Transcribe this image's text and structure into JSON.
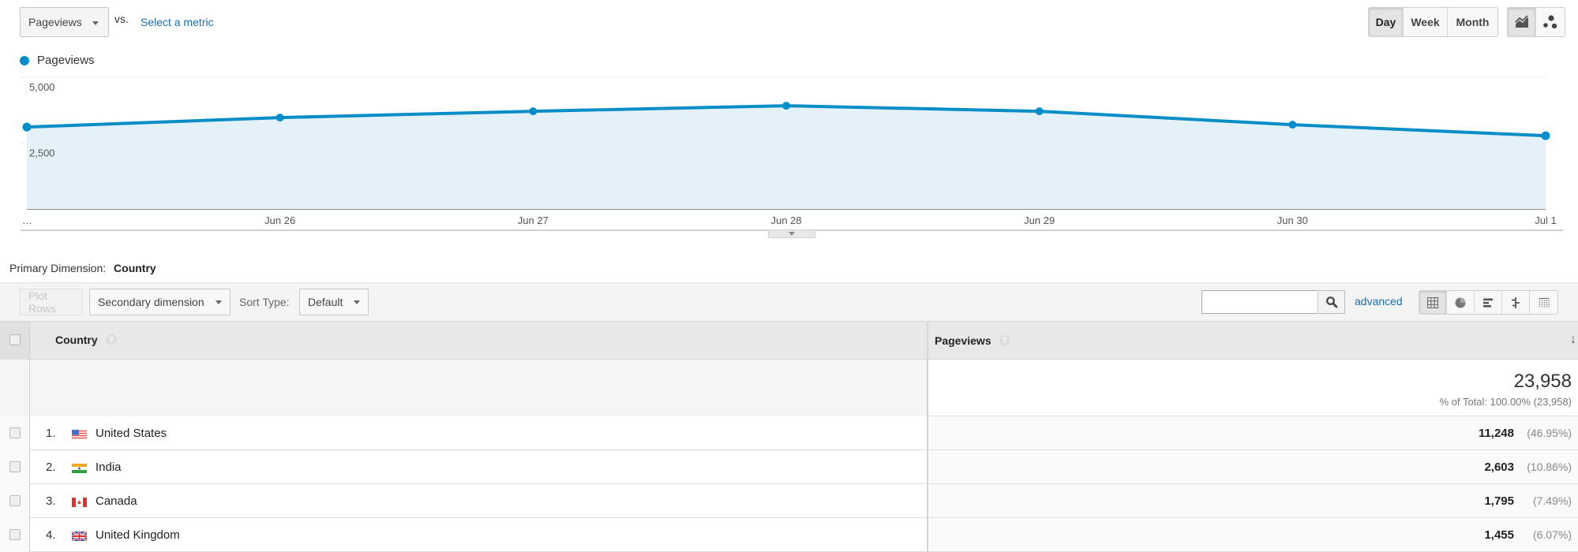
{
  "top_controls": {
    "metric_select": "Pageviews",
    "vs_label": "vs.",
    "select_metric_link": "Select a metric",
    "period_buttons": [
      {
        "label": "Day",
        "active": true
      },
      {
        "label": "Week",
        "active": false
      },
      {
        "label": "Month",
        "active": false
      }
    ],
    "chart_type_buttons": [
      {
        "icon": "line-chart-icon",
        "active": true
      },
      {
        "icon": "motion-chart-icon",
        "active": false
      }
    ]
  },
  "colors": {
    "series": "#058dc7",
    "area_fill": "#e5f1f9",
    "link": "#1a6fb0"
  },
  "chart_data": {
    "type": "area",
    "title": "",
    "legend": [
      "Pageviews"
    ],
    "legend_position": "top-left",
    "x": [
      "…",
      "Jun 26",
      "Jun 27",
      "Jun 28",
      "Jun 29",
      "Jun 30",
      "Jul 1"
    ],
    "series": [
      {
        "name": "Pageviews",
        "values": [
          3110,
          3470,
          3710,
          3920,
          3710,
          3200,
          2780
        ]
      }
    ],
    "y_ticks": [
      {
        "value": 5000,
        "label": "5,000"
      },
      {
        "value": 2500,
        "label": "2,500"
      }
    ],
    "ylim": [
      0,
      5000
    ],
    "grid": true,
    "xlabel": "",
    "ylabel": ""
  },
  "primary_dimension": {
    "label": "Primary Dimension:",
    "value": "Country"
  },
  "toolbar": {
    "plot_rows": "Plot Rows",
    "secondary_dimension": "Secondary dimension",
    "sort_type_label": "Sort Type:",
    "sort_type_value": "Default",
    "search_value": "",
    "search_placeholder": "",
    "advanced_link": "advanced",
    "view_buttons": [
      {
        "icon": "table-view-icon",
        "active": true
      },
      {
        "icon": "pie-view-icon",
        "active": false
      },
      {
        "icon": "performance-view-icon",
        "active": false
      },
      {
        "icon": "comparison-view-icon",
        "active": false
      },
      {
        "icon": "pivot-view-icon",
        "active": false
      }
    ]
  },
  "table": {
    "columns": [
      {
        "label": "Country",
        "help": "?"
      },
      {
        "label": "Pageviews",
        "help": "?",
        "sorted": "descending"
      }
    ],
    "totals": {
      "value": "23,958",
      "subtitle": "% of Total: 100.00% (23,958)"
    },
    "rows": [
      {
        "rank": "1.",
        "country": "United States",
        "flag": "us",
        "value": "11,248",
        "percent": "(46.95%)"
      },
      {
        "rank": "2.",
        "country": "India",
        "flag": "in",
        "value": "2,603",
        "percent": "(10.86%)"
      },
      {
        "rank": "3.",
        "country": "Canada",
        "flag": "ca",
        "value": "1,795",
        "percent": "(7.49%)"
      },
      {
        "rank": "4.",
        "country": "United Kingdom",
        "flag": "gb",
        "value": "1,455",
        "percent": "(6.07%)"
      }
    ]
  }
}
